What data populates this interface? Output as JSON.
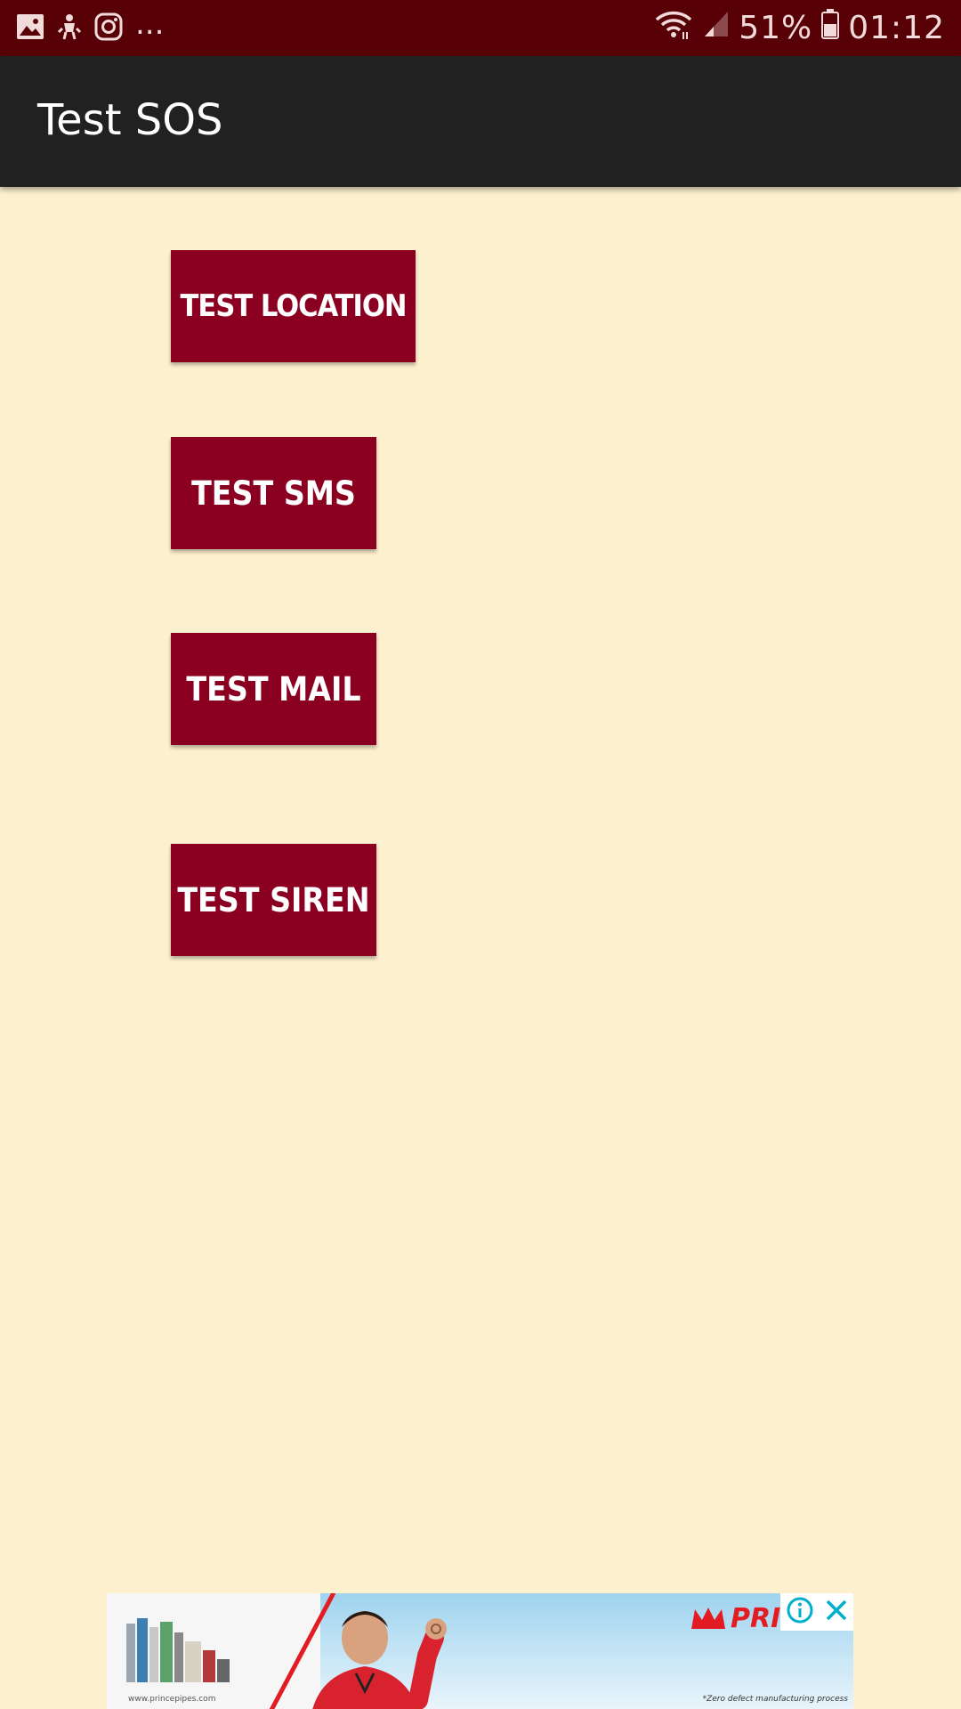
{
  "status_bar": {
    "icons_left": [
      "gallery-icon",
      "usb-debug-icon",
      "instagram-icon"
    ],
    "more": "...",
    "icons_right": [
      "wifi-icon",
      "signal-icon",
      "battery-icon"
    ],
    "battery": "51%",
    "time": "01:12"
  },
  "app_bar": {
    "title": "Test SOS"
  },
  "buttons": {
    "location": "TEST LOCATION",
    "sms": "TEST SMS",
    "mail": "TEST MAIL",
    "siren": "TEST SIREN"
  },
  "ad": {
    "brand": "PRI",
    "url": "www.princepipes.com",
    "tagline": "*Zero defect manufacturing process",
    "info_icon": "info-icon",
    "close_icon": "close-icon"
  },
  "colors": {
    "status_bar": "#570006",
    "app_bar": "#212121",
    "background": "#fdf0cf",
    "button": "#8b0020",
    "ad_brand": "#e31b23"
  }
}
